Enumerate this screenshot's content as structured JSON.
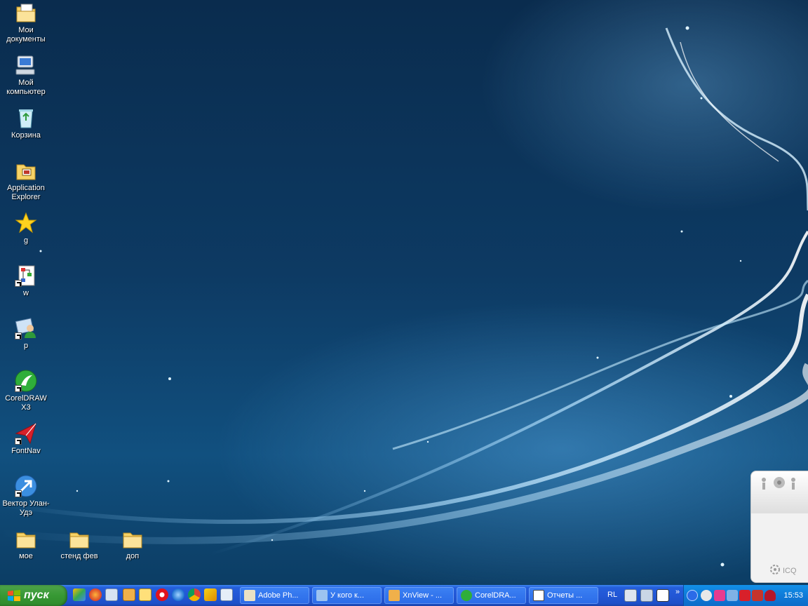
{
  "desktop": {
    "icons": [
      {
        "label": "Мои документы",
        "icon": "my-documents-icon"
      },
      {
        "label": "Мой компьютер",
        "icon": "my-computer-icon"
      },
      {
        "label": "Корзина",
        "icon": "recycle-bin-icon"
      },
      {
        "label": "Application Explorer",
        "icon": "folder-app-icon"
      },
      {
        "label": "g",
        "icon": "star-icon"
      },
      {
        "label": "w",
        "icon": "diagram-icon"
      },
      {
        "label": "p",
        "icon": "user-app-icon"
      },
      {
        "label": "CorelDRAW X3",
        "icon": "coreldraw-icon"
      },
      {
        "label": "FontNav",
        "icon": "fontnav-icon"
      },
      {
        "label": "Вектор Улан-Удэ",
        "icon": "vector-arrow-icon"
      },
      {
        "label": "мое",
        "icon": "folder-icon"
      },
      {
        "label": "стенд фев",
        "icon": "folder-icon"
      },
      {
        "label": "доп",
        "icon": "folder-icon"
      }
    ]
  },
  "icq_gadget": {
    "label": "ICQ"
  },
  "taskbar": {
    "start_label": "пуск",
    "tasks": [
      {
        "label": "Adobe Ph...",
        "icon": "photoshop-icon"
      },
      {
        "label": "У кого к...",
        "icon": "window-icon"
      },
      {
        "label": "XnView - ...",
        "icon": "xnview-icon"
      },
      {
        "label": "CorelDRA...",
        "icon": "coreldraw-icon"
      },
      {
        "label": "Отчеты ...",
        "icon": "document-icon"
      }
    ],
    "language": "RL",
    "clock": "15:53"
  },
  "colors": {
    "taskbar": "#245edb",
    "start_button": "#379934",
    "tray": "#0f7bd9"
  }
}
